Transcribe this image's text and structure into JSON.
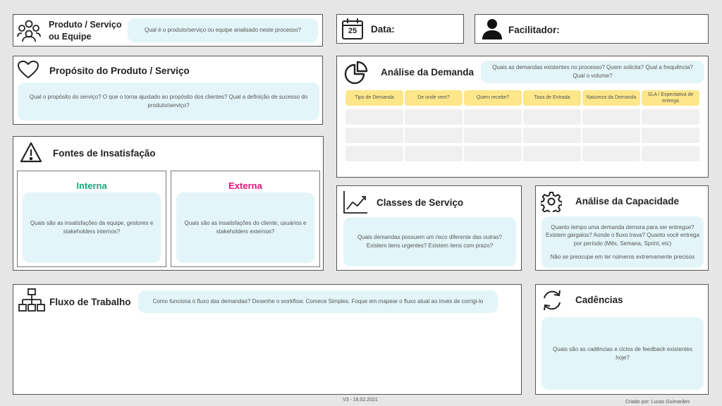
{
  "header": {
    "produto": {
      "title_line1": "Produto / Serviço",
      "title_line2": "ou Equipe",
      "note": "Qual é o produto/serviço ou equipe analisado neste processo?",
      "icon": "team-icon"
    },
    "data": {
      "label": "Data:",
      "icon": "calendar-icon",
      "calendar_day": "25"
    },
    "facilitador": {
      "label": "Facilitador:",
      "icon": "person-icon"
    }
  },
  "proposito": {
    "title": "Propósito do Produto / Serviço",
    "note": "Qual o propósito do serviço? O que o torna ajustado ao propósito dos clientes? Qual a definição de sucesso do produto/serviço?",
    "icon": "heart-icon"
  },
  "fontes": {
    "title": "Fontes de Insatisfação",
    "icon": "warning-icon",
    "interna": {
      "label": "Interna",
      "color": "#1aa37a",
      "note": "Quais são as insatisfações da equipe, gestores e stakeholders internos?"
    },
    "externa": {
      "label": "Externa",
      "color": "#e0127a",
      "note": "Quais são as insatisfações do cliente, usuários e stakeholders externos?"
    }
  },
  "demanda": {
    "title": "Análise da Demanda",
    "icon": "pie-chart-icon",
    "note": "Quais as demandas existentes no processo? Quem solicita? Qual a frequência? Qual o volume?",
    "columns": [
      "Tipo de Demanda",
      "De onde vem?",
      "Quem recebe?",
      "Taxa de Entrada",
      "Natureza da Demanda",
      "SLA / Expectativa de entrega"
    ],
    "empty_rows": 3
  },
  "classes": {
    "title": "Classes de Serviço",
    "icon": "trend-chart-icon",
    "note": "Quais demandas possuem um risco diferente das outras? Existem itens urgentes? Existem itens com prazo?"
  },
  "capacidade": {
    "title": "Análise da Capacidade",
    "icon": "gear-icon",
    "note": "Quanto tempo uma demanda demora para ser entregue? Existem gargalos? Aonde o fluxo trava? Quanto você entrega por período (Mês, Semana, Sprint, etc)",
    "note2": "Não se preocupe em ter números extremamente precisos"
  },
  "fluxo": {
    "title": "Fluxo de Trabalho",
    "icon": "org-chart-icon",
    "note": "Como funciona o fluxo das demandas? Desenhe o workflow. Comece Simples. Foque em mapear o fluxo atual ao invés de corrigi-lo"
  },
  "cadencias": {
    "title": "Cadências",
    "icon": "refresh-icon",
    "note": "Quais são as cadências e ciclos de feedback existentes hoje?"
  },
  "footer": {
    "version": "V3 - 18.02.2021",
    "credit": "Criado por: Lucas Guimarães"
  },
  "colors": {
    "note_bg": "#e3f5f8",
    "table_header": "#fde78a",
    "interna": "#1aa37a",
    "externa": "#e0127a"
  }
}
